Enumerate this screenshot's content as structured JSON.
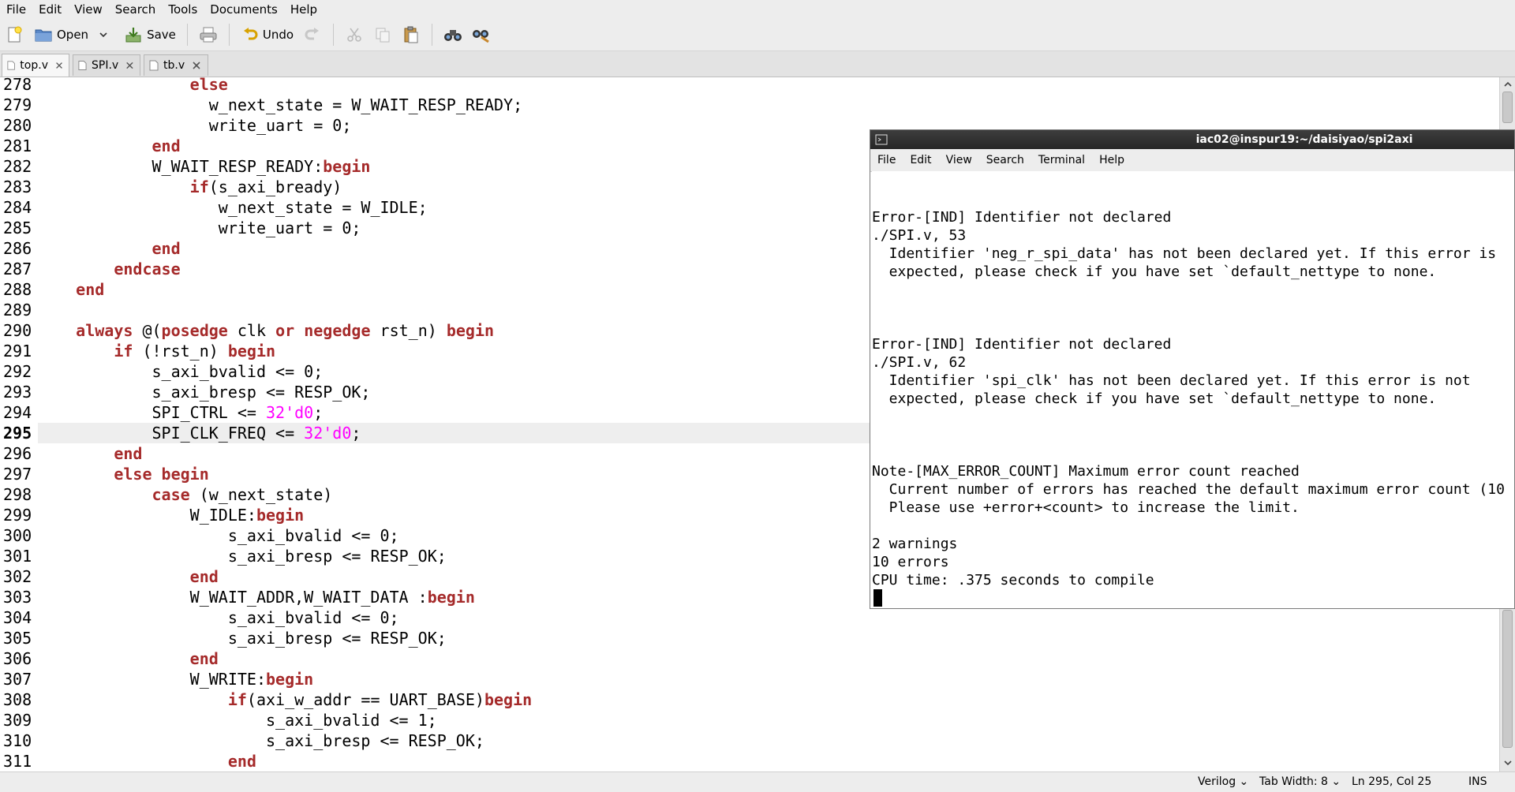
{
  "menubar": [
    "File",
    "Edit",
    "View",
    "Search",
    "Tools",
    "Documents",
    "Help"
  ],
  "toolbar": {
    "open_label": "Open",
    "save_label": "Save",
    "undo_label": "Undo"
  },
  "tabs": [
    {
      "label": "top.v",
      "active": true
    },
    {
      "label": "SPI.v",
      "active": false
    },
    {
      "label": "tb.v",
      "active": false
    }
  ],
  "editor": {
    "current_line": 295,
    "lines": [
      {
        "n": "278",
        "i": "                ",
        "t": [
          [
            "kw",
            "else"
          ]
        ]
      },
      {
        "n": "279",
        "i": "                  ",
        "t": [
          [
            "p",
            "w_next_state = W_WAIT_RESP_READY;"
          ]
        ]
      },
      {
        "n": "280",
        "i": "                  ",
        "t": [
          [
            "p",
            "write_uart = 0;"
          ]
        ]
      },
      {
        "n": "281",
        "i": "            ",
        "t": [
          [
            "kw",
            "end"
          ]
        ]
      },
      {
        "n": "282",
        "i": "            ",
        "t": [
          [
            "p",
            "W_WAIT_RESP_READY:"
          ],
          [
            "kw",
            "begin"
          ]
        ]
      },
      {
        "n": "283",
        "i": "                ",
        "t": [
          [
            "kw",
            "if"
          ],
          [
            "p",
            "(s_axi_bready)"
          ]
        ]
      },
      {
        "n": "284",
        "i": "                   ",
        "t": [
          [
            "p",
            "w_next_state = W_IDLE;"
          ]
        ]
      },
      {
        "n": "285",
        "i": "                   ",
        "t": [
          [
            "p",
            "write_uart = 0;"
          ]
        ]
      },
      {
        "n": "286",
        "i": "            ",
        "t": [
          [
            "kw",
            "end"
          ]
        ]
      },
      {
        "n": "287",
        "i": "        ",
        "t": [
          [
            "kw",
            "endcase"
          ]
        ]
      },
      {
        "n": "288",
        "i": "    ",
        "t": [
          [
            "kw",
            "end"
          ]
        ]
      },
      {
        "n": "289",
        "i": "",
        "t": []
      },
      {
        "n": "290",
        "i": "    ",
        "t": [
          [
            "kw",
            "always"
          ],
          [
            "p",
            " @("
          ],
          [
            "kw",
            "posedge"
          ],
          [
            "p",
            " clk "
          ],
          [
            "kw",
            "or"
          ],
          [
            "p",
            " "
          ],
          [
            "kw",
            "negedge"
          ],
          [
            "p",
            " rst_n) "
          ],
          [
            "kw",
            "begin"
          ]
        ]
      },
      {
        "n": "291",
        "i": "        ",
        "t": [
          [
            "kw",
            "if"
          ],
          [
            "p",
            " (!rst_n) "
          ],
          [
            "kw",
            "begin"
          ]
        ]
      },
      {
        "n": "292",
        "i": "            ",
        "t": [
          [
            "p",
            "s_axi_bvalid <= 0;"
          ]
        ]
      },
      {
        "n": "293",
        "i": "            ",
        "t": [
          [
            "p",
            "s_axi_bresp <= RESP_OK;"
          ]
        ]
      },
      {
        "n": "294",
        "i": "            ",
        "t": [
          [
            "p",
            "SPI_CTRL <= "
          ],
          [
            "num",
            "32'd0"
          ],
          [
            "p",
            ";"
          ]
        ]
      },
      {
        "n": "295",
        "i": "            ",
        "t": [
          [
            "p",
            "SPI_CLK_FREQ <= "
          ],
          [
            "num",
            "32'd0"
          ],
          [
            "p",
            ";"
          ]
        ]
      },
      {
        "n": "296",
        "i": "        ",
        "t": [
          [
            "kw",
            "end"
          ]
        ]
      },
      {
        "n": "297",
        "i": "        ",
        "t": [
          [
            "kw",
            "else"
          ],
          [
            "p",
            " "
          ],
          [
            "kw",
            "begin"
          ]
        ]
      },
      {
        "n": "298",
        "i": "            ",
        "t": [
          [
            "kw",
            "case"
          ],
          [
            "p",
            " (w_next_state)"
          ]
        ]
      },
      {
        "n": "299",
        "i": "                ",
        "t": [
          [
            "p",
            "W_IDLE:"
          ],
          [
            "kw",
            "begin"
          ]
        ]
      },
      {
        "n": "300",
        "i": "                    ",
        "t": [
          [
            "p",
            "s_axi_bvalid <= 0;"
          ]
        ]
      },
      {
        "n": "301",
        "i": "                    ",
        "t": [
          [
            "p",
            "s_axi_bresp <= RESP_OK;"
          ]
        ]
      },
      {
        "n": "302",
        "i": "                ",
        "t": [
          [
            "kw",
            "end"
          ]
        ]
      },
      {
        "n": "303",
        "i": "                ",
        "t": [
          [
            "p",
            "W_WAIT_ADDR,W_WAIT_DATA :"
          ],
          [
            "kw",
            "begin"
          ]
        ]
      },
      {
        "n": "304",
        "i": "                    ",
        "t": [
          [
            "p",
            "s_axi_bvalid <= 0;"
          ]
        ]
      },
      {
        "n": "305",
        "i": "                    ",
        "t": [
          [
            "p",
            "s_axi_bresp <= RESP_OK;"
          ]
        ]
      },
      {
        "n": "306",
        "i": "                ",
        "t": [
          [
            "kw",
            "end"
          ]
        ]
      },
      {
        "n": "307",
        "i": "                ",
        "t": [
          [
            "p",
            "W_WRITE:"
          ],
          [
            "kw",
            "begin"
          ]
        ]
      },
      {
        "n": "308",
        "i": "                    ",
        "t": [
          [
            "kw",
            "if"
          ],
          [
            "p",
            "(axi_w_addr == UART_BASE)"
          ],
          [
            "kw",
            "begin"
          ]
        ]
      },
      {
        "n": "309",
        "i": "                        ",
        "t": [
          [
            "p",
            "s_axi_bvalid <= 1;"
          ]
        ]
      },
      {
        "n": "310",
        "i": "                        ",
        "t": [
          [
            "p",
            "s_axi_bresp <= RESP_OK;"
          ]
        ]
      },
      {
        "n": "311",
        "i": "                    ",
        "t": [
          [
            "kw",
            "end"
          ]
        ]
      }
    ]
  },
  "statusbar": {
    "language": "Verilog",
    "tab_width": "Tab Width: 8",
    "position": "Ln 295, Col 25",
    "mode": "INS"
  },
  "terminal": {
    "title": "iac02@inspur19:~/daisiyao/spi2axi",
    "menu": [
      "File",
      "Edit",
      "View",
      "Search",
      "Terminal",
      "Help"
    ],
    "lines": [
      "",
      "",
      "Error-[IND] Identifier not declared",
      "./SPI.v, 53",
      "  Identifier 'neg_r_spi_data' has not been declared yet. If this error is",
      "  expected, please check if you have set `default_nettype to none.",
      "",
      "",
      "",
      "Error-[IND] Identifier not declared",
      "./SPI.v, 62",
      "  Identifier 'spi_clk' has not been declared yet. If this error is not",
      "  expected, please check if you have set `default_nettype to none.",
      "",
      "",
      "",
      "Note-[MAX_ERROR_COUNT] Maximum error count reached",
      "  Current number of errors has reached the default maximum error count (10",
      "  Please use +error+<count> to increase the limit.",
      "",
      "2 warnings",
      "10 errors",
      "CPU time: .375 seconds to compile"
    ]
  },
  "colors": {
    "keyword": "#a52a2a",
    "number": "#ff00ff",
    "current_line_bg": "#eeeeee"
  }
}
